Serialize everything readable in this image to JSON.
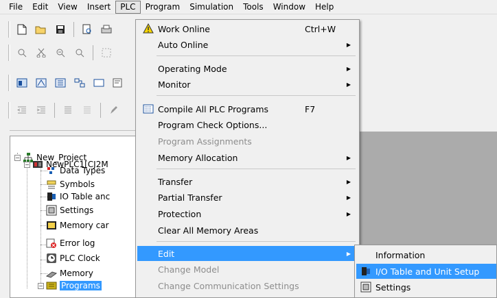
{
  "menubar": {
    "items": [
      "File",
      "Edit",
      "View",
      "Insert",
      "PLC",
      "Program",
      "Simulation",
      "Tools",
      "Window",
      "Help"
    ]
  },
  "plc_menu": {
    "items": [
      {
        "label": "Work Online",
        "shortcut": "Ctrl+W",
        "icon": "warning-icon",
        "state": "enabled"
      },
      {
        "label": "Auto Online",
        "submenu": true,
        "state": "enabled"
      },
      {
        "label": "Operating Mode",
        "submenu": true,
        "state": "enabled"
      },
      {
        "label": "Monitor",
        "submenu": true,
        "state": "enabled"
      },
      {
        "label": "Compile All PLC Programs",
        "shortcut": "F7",
        "icon": "compile-icon",
        "state": "enabled"
      },
      {
        "label": "Program Check Options...",
        "state": "enabled"
      },
      {
        "label": "Program Assignments",
        "state": "disabled"
      },
      {
        "label": "Memory Allocation",
        "submenu": true,
        "state": "enabled"
      },
      {
        "label": "Transfer",
        "submenu": true,
        "state": "enabled"
      },
      {
        "label": "Partial Transfer",
        "submenu": true,
        "state": "enabled"
      },
      {
        "label": "Protection",
        "submenu": true,
        "state": "enabled"
      },
      {
        "label": "Clear All Memory Areas",
        "state": "enabled"
      },
      {
        "label": "Edit",
        "submenu": true,
        "state": "highlighted"
      },
      {
        "label": "Change Model",
        "state": "disabled"
      },
      {
        "label": "Change Communication Settings",
        "state": "disabled"
      }
    ]
  },
  "edit_submenu": {
    "items": [
      {
        "label": "Information",
        "state": "enabled"
      },
      {
        "label": "I/O Table and Unit Setup",
        "icon": "io-table-icon",
        "state": "highlighted"
      },
      {
        "label": "Settings",
        "icon": "settings-icon",
        "state": "enabled"
      }
    ]
  },
  "tree": {
    "project": "New_Project",
    "plc": "NewPLC1[CJ2M",
    "children": [
      "Data Types",
      "Symbols",
      "IO Table anc",
      "Settings",
      "Memory car",
      "Error log",
      "PLC Clock",
      "Memory",
      "Programs"
    ]
  },
  "colors": {
    "highlight": "#3399ff",
    "workspace": "#ababab",
    "menu_bg": "#f0f0f0",
    "disabled_text": "#8d8d8d"
  }
}
